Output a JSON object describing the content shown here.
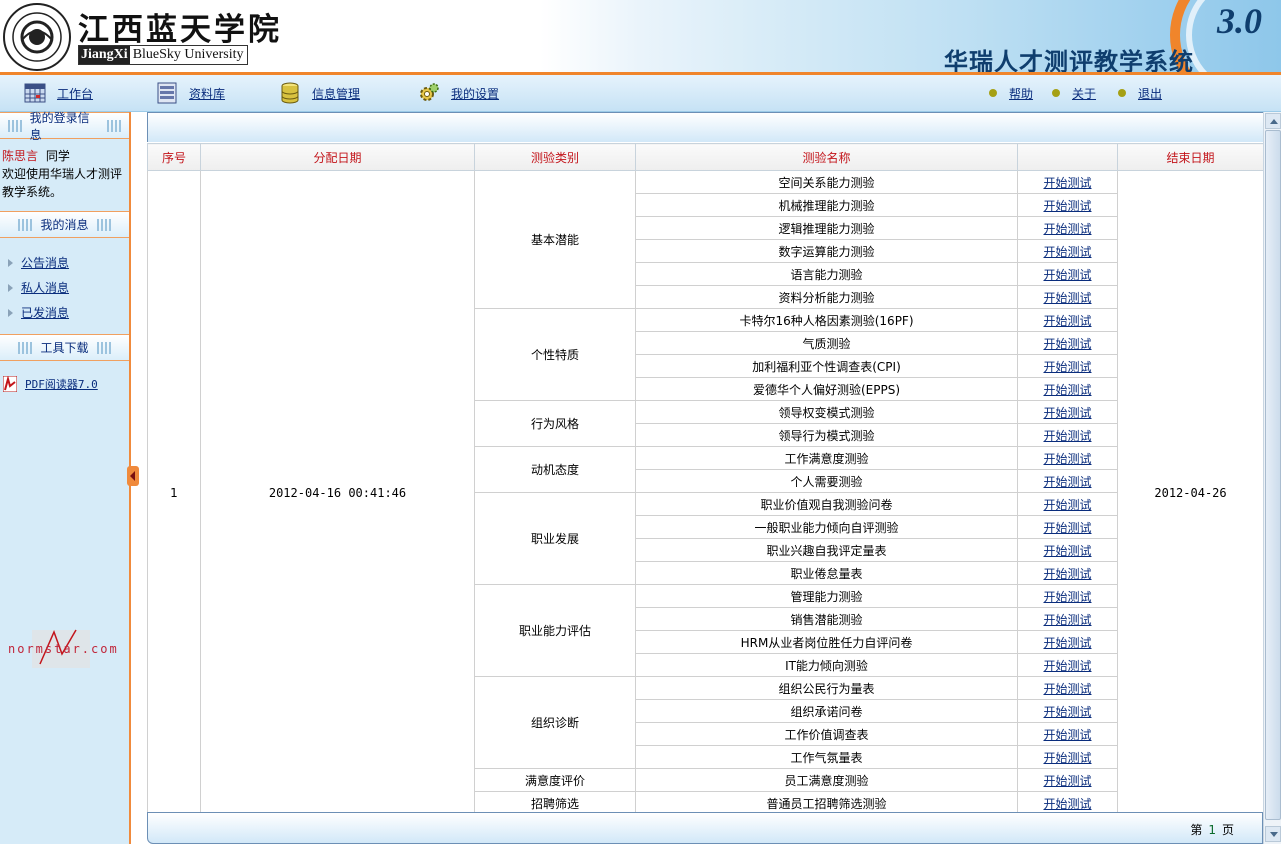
{
  "header": {
    "school_name_cn": "江西蓝天学院",
    "school_name_en_a": "JiangXi",
    "school_name_en_b": "BlueSky University",
    "system_title": "华瑞人才测评教学系统",
    "version": "3.0"
  },
  "nav": {
    "left": [
      {
        "label": "工作台",
        "icon": "workbench-icon"
      },
      {
        "label": "资料库",
        "icon": "library-icon"
      },
      {
        "label": "信息管理",
        "icon": "database-icon"
      },
      {
        "label": "我的设置",
        "icon": "settings-gear-icon"
      }
    ],
    "right": [
      {
        "label": "帮助"
      },
      {
        "label": "关于"
      },
      {
        "label": "退出"
      }
    ]
  },
  "sidebar": {
    "login_info_title": "我的登录信息",
    "user_name": "陈思言",
    "user_role": "同学",
    "welcome": "欢迎使用华瑞人才测评教学系统。",
    "messages_title": "我的消息",
    "messages": [
      {
        "label": "公告消息"
      },
      {
        "label": "私人消息"
      },
      {
        "label": "已发消息"
      }
    ],
    "tools_title": "工具下载",
    "tools": [
      {
        "label": "PDF阅读器7.0",
        "icon": "pdf-icon"
      }
    ],
    "watermark": "normstar.com"
  },
  "table": {
    "headers": [
      "序号",
      "分配日期",
      "测验类别",
      "测验名称",
      "",
      "结束日期"
    ],
    "row_index": "1",
    "assign_date": "2012-04-16 00:41:46",
    "end_date": "2012-04-26",
    "action_label": "开始测试",
    "groups": [
      {
        "category": "基本潜能",
        "tests": [
          "空间关系能力测验",
          "机械推理能力测验",
          "逻辑推理能力测验",
          "数字运算能力测验",
          "语言能力测验",
          "资料分析能力测验"
        ]
      },
      {
        "category": "个性特质",
        "tests": [
          "卡特尔16种人格因素测验(16PF)",
          "气质测验",
          "加利福利亚个性调查表(CPI)",
          "爱德华个人偏好测验(EPPS)"
        ]
      },
      {
        "category": "行为风格",
        "tests": [
          "领导权变模式测验",
          "领导行为模式测验"
        ]
      },
      {
        "category": "动机态度",
        "tests": [
          "工作满意度测验",
          "个人需要测验"
        ]
      },
      {
        "category": "职业发展",
        "tests": [
          "职业价值观自我测验问卷",
          "一般职业能力倾向自评测验",
          "职业兴趣自我评定量表",
          "职业倦怠量表"
        ]
      },
      {
        "category": "职业能力评估",
        "tests": [
          "管理能力测验",
          "销售潜能测验",
          "HRM从业者岗位胜任力自评问卷",
          "IT能力倾向测验"
        ]
      },
      {
        "category": "组织诊断",
        "tests": [
          "组织公民行为量表",
          "组织承诺问卷",
          "工作价值调查表",
          "工作气氛量表"
        ]
      },
      {
        "category": "满意度评价",
        "tests": [
          "员工满意度测验"
        ]
      },
      {
        "category": "招聘筛选",
        "tests": [
          "普通员工招聘筛选测验"
        ]
      }
    ]
  },
  "pager": {
    "prefix": "第",
    "page": "1",
    "suffix": "页"
  },
  "colors": {
    "accent_orange": "#f0852b",
    "link_blue": "#0a2d7d",
    "header_red": "#c3151b",
    "sidebar_bg": "#d6ebf8"
  }
}
